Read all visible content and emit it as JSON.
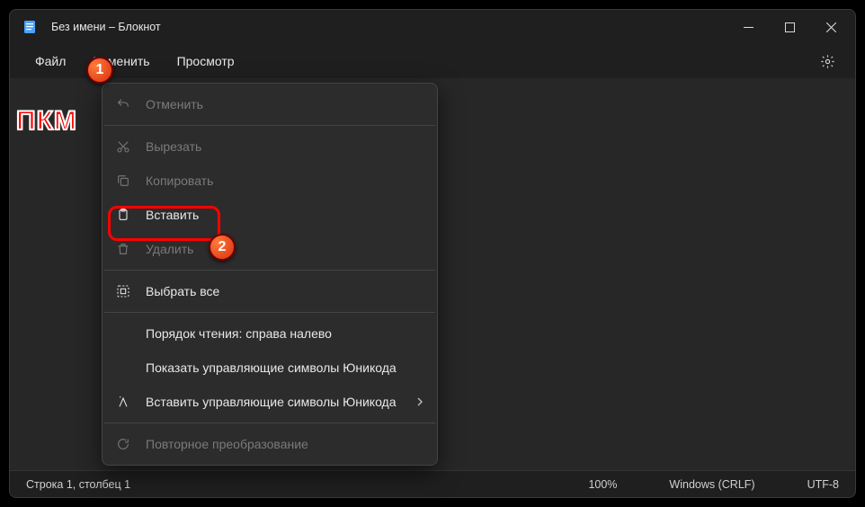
{
  "titlebar": {
    "title": "Без имени – Блокнот"
  },
  "menubar": {
    "file": "Файл",
    "edit": "Изменить",
    "view": "Просмотр"
  },
  "context_menu": {
    "undo": "Отменить",
    "cut": "Вырезать",
    "copy": "Копировать",
    "paste": "Вставить",
    "delete": "Удалить",
    "select_all": "Выбрать все",
    "reading_order": "Порядок чтения: справа налево",
    "show_unicode": "Показать управляющие символы Юникода",
    "insert_unicode": "Вставить управляющие символы Юникода",
    "reconvert": "Повторное преобразование"
  },
  "statusbar": {
    "position": "Строка 1, столбец 1",
    "zoom": "100%",
    "line_ending": "Windows (CRLF)",
    "encoding": "UTF-8"
  },
  "annotations": {
    "pkm": "ПКМ",
    "badge1": "1",
    "badge2": "2"
  }
}
